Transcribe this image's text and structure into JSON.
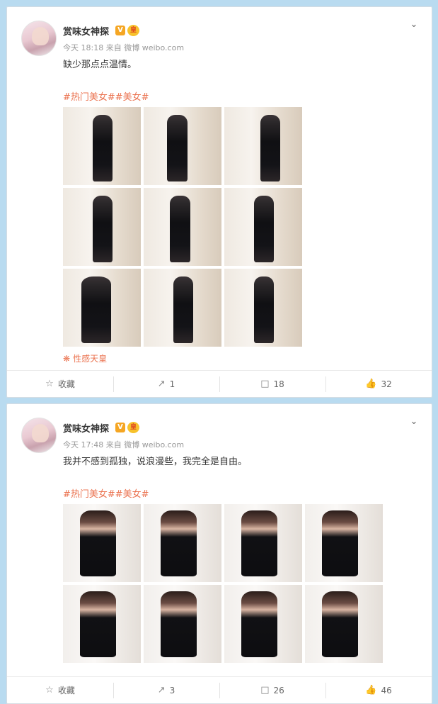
{
  "posts": [
    {
      "nickname": "赏味女神探",
      "vip_badge": "V",
      "crown_badge": "皇",
      "time": "今天 18:18",
      "source_prefix": "来自",
      "source_app": "微博 weibo.com",
      "text": "缺少那点点温情。",
      "tags": "#热门美女##美女#",
      "tag_source": "性感天皇",
      "images": 9,
      "actions": {
        "favorite": "收藏",
        "repost": "1",
        "comment": "18",
        "like": "32"
      }
    },
    {
      "nickname": "赏味女神探",
      "vip_badge": "V",
      "crown_badge": "皇",
      "time": "今天 17:48",
      "source_prefix": "来自",
      "source_app": "微博 weibo.com",
      "text": "我并不感到孤独，说浪漫些，我完全是自由。",
      "tags": "#热门美女##美女#",
      "images": 8,
      "actions": {
        "favorite": "收藏",
        "repost": "3",
        "comment": "26",
        "like": "46"
      }
    }
  ],
  "icons": {
    "chevron": "chevron-down-icon",
    "favorite": "star-icon",
    "repost": "share-icon",
    "comment": "comment-icon",
    "like": "thumbs-up-icon",
    "source": "flower-icon"
  },
  "colors": {
    "tag": "#eb7350",
    "background": "#b9dbf0",
    "vip": "#f5a623"
  }
}
